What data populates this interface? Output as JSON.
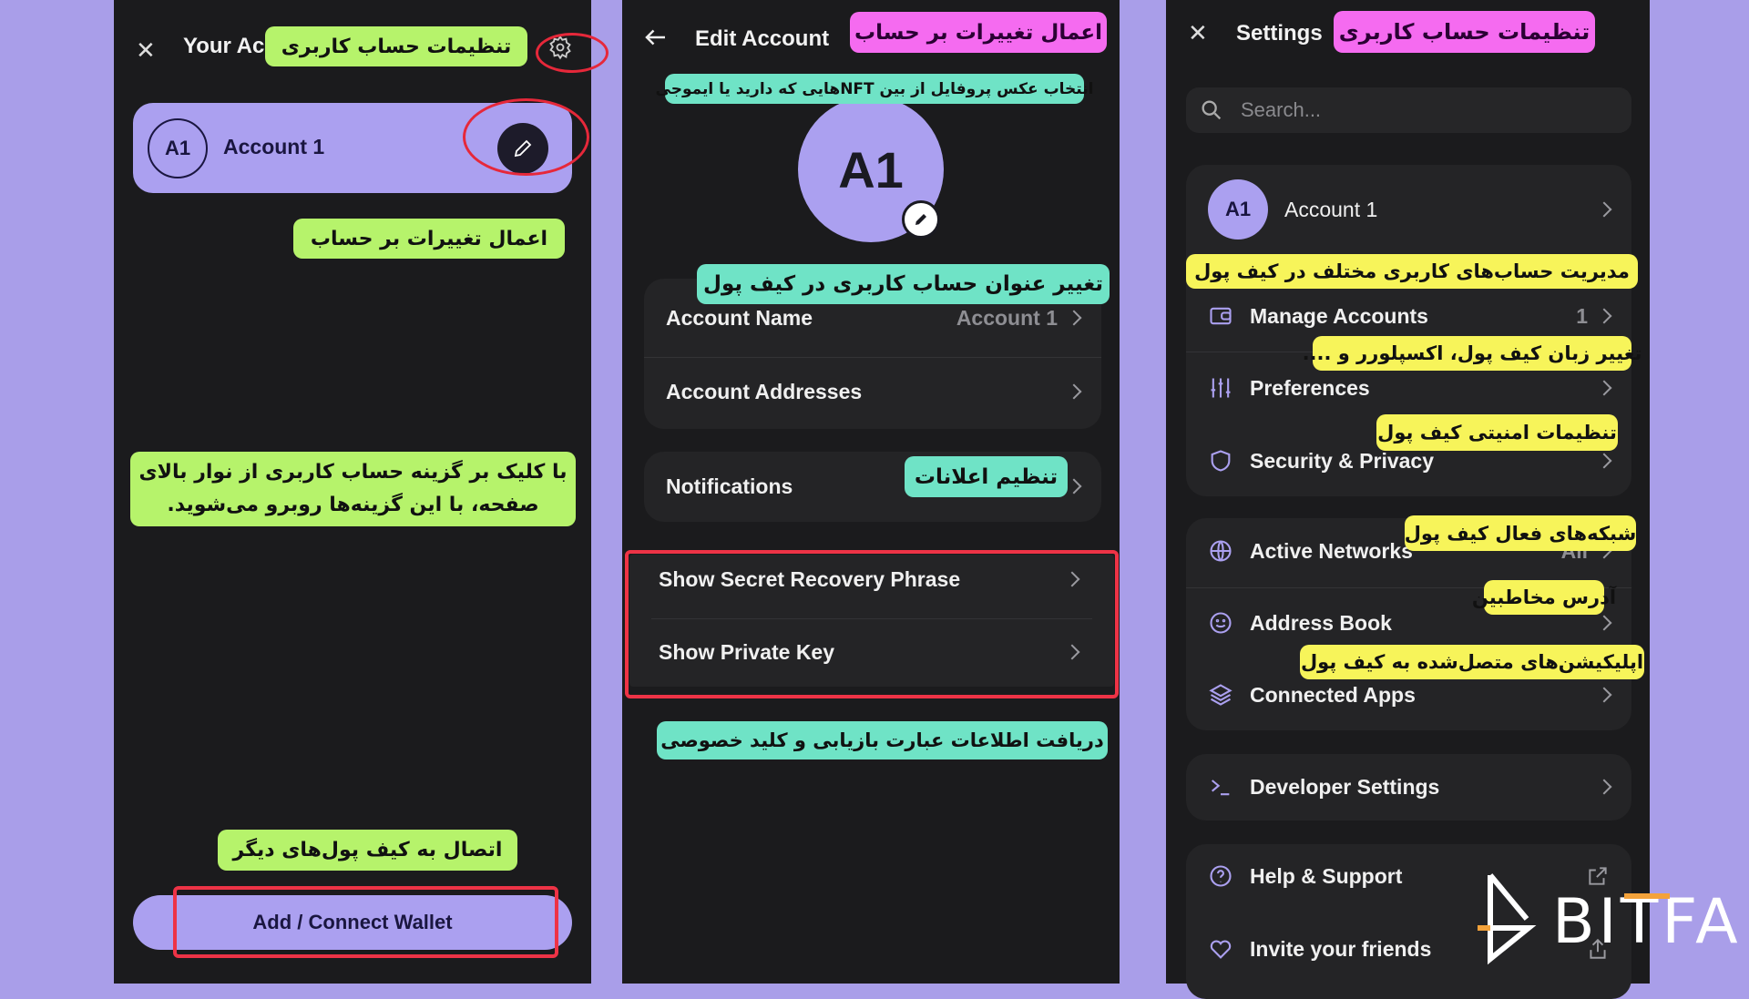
{
  "colors": {
    "background": "#a99ee9",
    "panel": "#1b1b1d",
    "accent": "#aba0f0",
    "highlight": "#ee3346"
  },
  "left": {
    "title": "Your Ac",
    "account": {
      "avatar": "A1",
      "name": "Account 1"
    },
    "add_wallet": "Add / Connect Wallet",
    "notes": {
      "settings": "تنظیمات حساب کاربری",
      "edit": "اعمال تغییرات بر حساب",
      "info_line1": "با کلیک بر گزینه حساب کاربری از نوار بالای",
      "info_line2": "صفحه، با این گزینه‌ها روبرو می‌شوید.",
      "connect": "اتصال به کیف پول‌های دیگر"
    }
  },
  "middle": {
    "title": "Edit Account",
    "avatar": "A1",
    "rows": {
      "account_name": "Account Name",
      "account_name_value": "Account 1",
      "addresses": "Account Addresses",
      "notifications": "Notifications",
      "secret": "Show Secret Recovery Phrase",
      "private_key": "Show Private Key"
    },
    "notes": {
      "apply": "اعمال تغییرات بر حساب",
      "nft": "انتخاب عکس پروفایل از بین NFTهایی که دارید یا ایموجی",
      "rename": "تغییر عنوان حساب کاربری در کیف پول",
      "notif": "تنظیم اعلانات",
      "secret": "دریافت اطلاعات عبارت بازیابی و کلید خصوصی"
    }
  },
  "right": {
    "title": "Settings",
    "search_placeholder": "Search...",
    "account": {
      "avatar": "A1",
      "name": "Account 1"
    },
    "items": {
      "manage": "Manage Accounts",
      "manage_count": "1",
      "preferences": "Preferences",
      "security": "Security & Privacy",
      "networks": "Active Networks",
      "networks_value": "All",
      "address_book": "Address Book",
      "connected": "Connected Apps",
      "developer": "Developer Settings",
      "help": "Help & Support",
      "invite": "Invite your friends"
    },
    "notes": {
      "title": "تنظیمات حساب کاربری",
      "manage": "مدیریت حساب‌های کاربری مختلف در کیف پول",
      "prefs": "تغییر زبان کیف پول، اکسپلورر و ....",
      "security": "تنظیمات امنیتی کیف پول",
      "networks": "شبکه‌های فعال کیف پول",
      "address": "آدرس مخاطبین",
      "apps": "اپلیکیشن‌های متصل‌شده به کیف پول"
    }
  },
  "watermark": "BITFA"
}
